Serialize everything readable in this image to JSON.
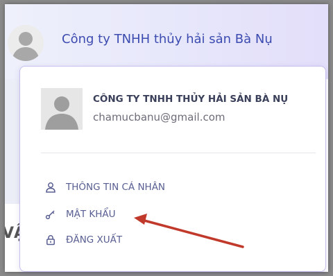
{
  "header": {
    "company_title": "Công ty TNHH thủy hải sản Bà Nụ",
    "partial_text": "VẬ"
  },
  "account_menu": {
    "display_name": "CÔNG TY TNHH THỦY HẢI SẢN BÀ NỤ",
    "email": "chamucbanu@gmail.com",
    "items": [
      {
        "icon": "user-icon",
        "label": "THÔNG TIN CÁ NHÂN"
      },
      {
        "icon": "key-icon",
        "label": "MẬT KHẨU"
      },
      {
        "icon": "lock-icon",
        "label": "ĐĂNG XUẤT"
      }
    ]
  },
  "colors": {
    "accent": "#3c4bb0",
    "menu_text": "#585e92",
    "annotation_arrow": "#c0392b"
  }
}
